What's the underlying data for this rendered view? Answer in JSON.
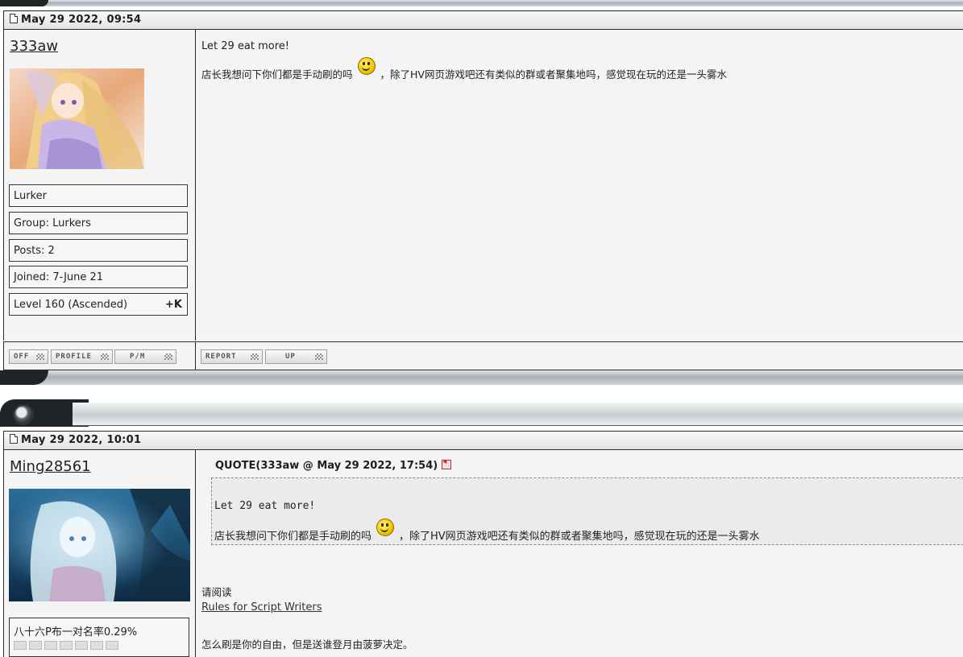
{
  "posts": [
    {
      "timestamp": "May 29 2022, 09:54",
      "author": "333aw",
      "info": {
        "title": "Lurker",
        "group": "Group: Lurkers",
        "posts": "Posts: 2",
        "joined": "Joined: 7-June 21",
        "level": "Level 160 (Ascended)",
        "karma": "+K"
      },
      "content": {
        "line1": "Let 29 eat more!",
        "line2_a": "店长我想问下你们都是手动刷的吗",
        "line2_b": "，除了HV网页游戏吧还有类似的群或者聚集地吗，感觉现在玩的还是一头雾水"
      },
      "left_buttons": [
        "OFF",
        "PROFILE",
        "P/M"
      ],
      "right_buttons": [
        "REPORT",
        "UP"
      ]
    },
    {
      "timestamp": "May 29 2022, 10:01",
      "author": "Ming28561",
      "info": {
        "title": "八十六P布一对名率0.29%"
      },
      "quote": {
        "header": "QUOTE(333aw @ May 29 2022, 17:54)",
        "line1": "Let 29 eat more!",
        "line2_a": "店长我想问下你们都是手动刷的吗",
        "line2_b": "，除了HV网页游戏吧还有类似的群或者聚集地吗，感觉现在玩的还是一头雾水"
      },
      "content": {
        "read_prompt": "请阅读",
        "link": "Rules for Script Writers",
        "final": "怎么刷是你的自由，但是送谁登月由菠萝决定。"
      }
    }
  ],
  "icons": [
    "page-icon",
    "smiley-icon",
    "quote-jump-icon"
  ]
}
